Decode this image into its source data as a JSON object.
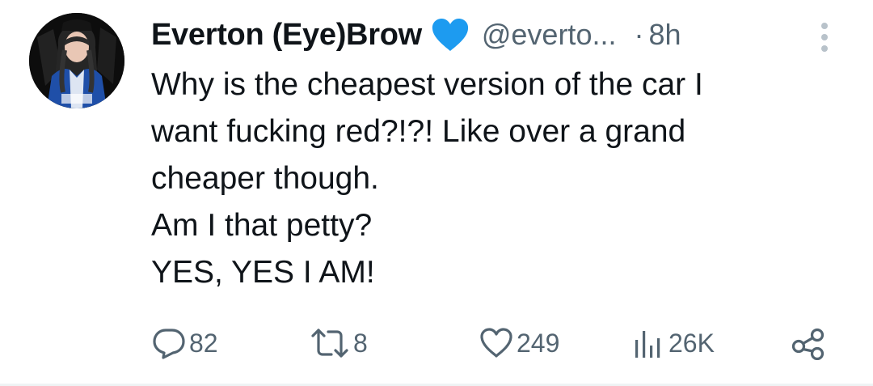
{
  "tweet": {
    "author": {
      "display_name": "Everton (Eye)Brow",
      "badge_icon": "blue-heart-icon",
      "handle": "@everto...",
      "separator": "·",
      "time": "8h"
    },
    "text_lines": [
      "Why is the cheapest version of the car I",
      "want fucking red?!?! Like over a grand",
      "cheaper though.",
      "Am I that petty?",
      "YES, YES I AM!"
    ],
    "actions": {
      "replies": "82",
      "reposts": "8",
      "likes": "249",
      "views": "26K"
    }
  },
  "colors": {
    "text": "#0f1419",
    "secondary": "#536471",
    "badge": "#1d9bf0",
    "divider": "#eff3f4"
  }
}
